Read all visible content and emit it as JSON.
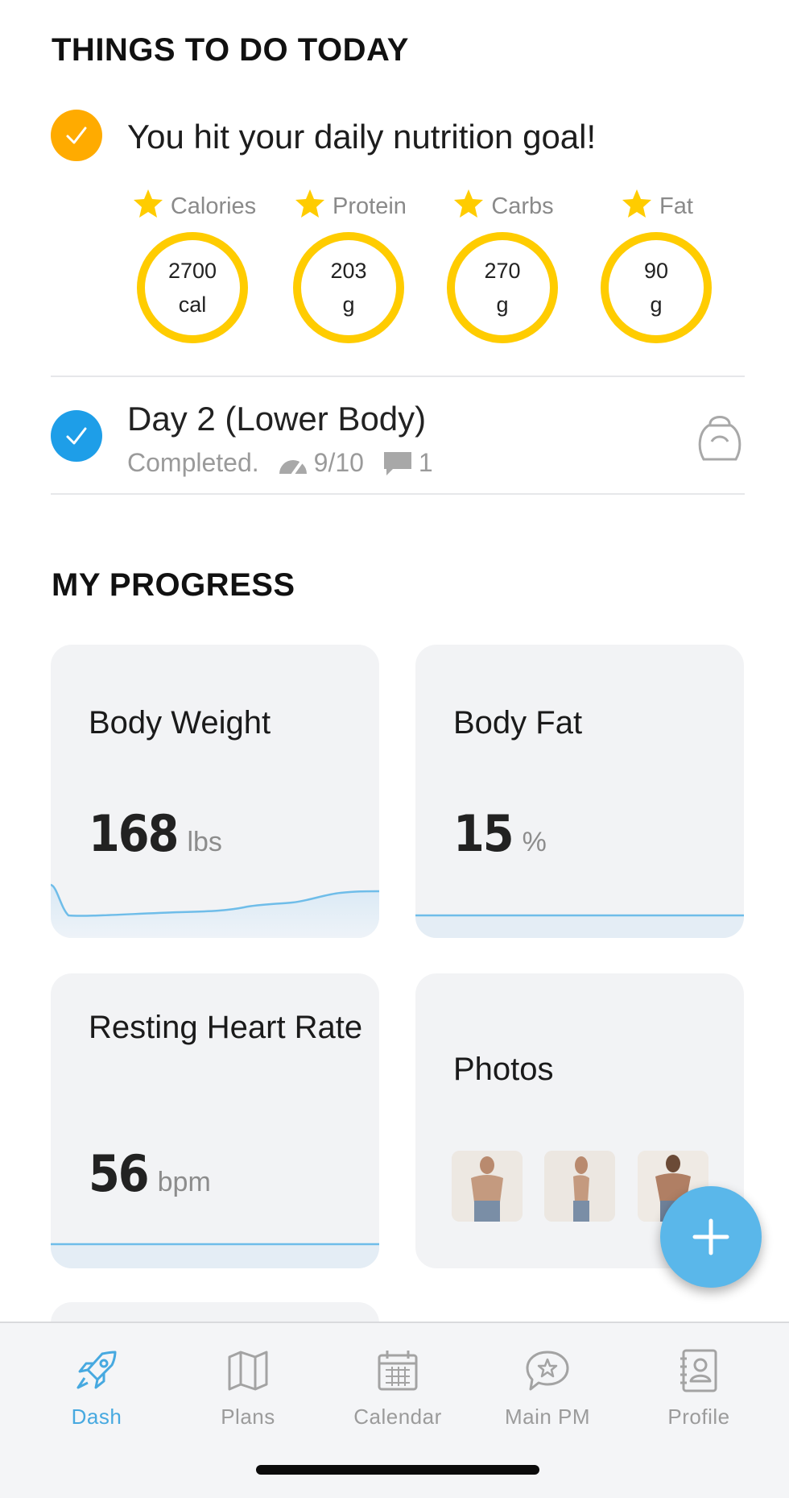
{
  "todo": {
    "title": "THINGS TO DO TODAY",
    "nutrition_message": "You hit your daily nutrition goal!",
    "macros": [
      {
        "label": "Calories",
        "value": "2700",
        "unit": "cal"
      },
      {
        "label": "Protein",
        "value": "203",
        "unit": "g"
      },
      {
        "label": "Carbs",
        "value": "270",
        "unit": "g"
      },
      {
        "label": "Fat",
        "value": "90",
        "unit": "g"
      }
    ],
    "workout": {
      "title": "Day 2 (Lower Body)",
      "status": "Completed.",
      "rating": "9/10",
      "comments": "1"
    }
  },
  "progress": {
    "title": "MY PROGRESS",
    "body_weight": {
      "title": "Body Weight",
      "value": "168",
      "unit": "lbs"
    },
    "body_fat": {
      "title": "Body Fat",
      "value": "15",
      "unit": "%"
    },
    "heart_rate": {
      "title": "Resting Heart Rate",
      "value": "56",
      "unit": "bpm"
    },
    "photos": {
      "title": "Photos"
    }
  },
  "tabs": [
    {
      "label": "Dash",
      "icon": "rocket-icon",
      "active": true
    },
    {
      "label": "Plans",
      "icon": "map-icon",
      "active": false
    },
    {
      "label": "Calendar",
      "icon": "calendar-icon",
      "active": false
    },
    {
      "label": "Main PM",
      "icon": "chat-star-icon",
      "active": false
    },
    {
      "label": "Profile",
      "icon": "contact-book-icon",
      "active": false
    }
  ],
  "colors": {
    "accent_blue": "#47a9e0",
    "goal_yellow": "#ffcc00",
    "check_orange": "#ffab00",
    "check_blue": "#1e9ee8"
  }
}
